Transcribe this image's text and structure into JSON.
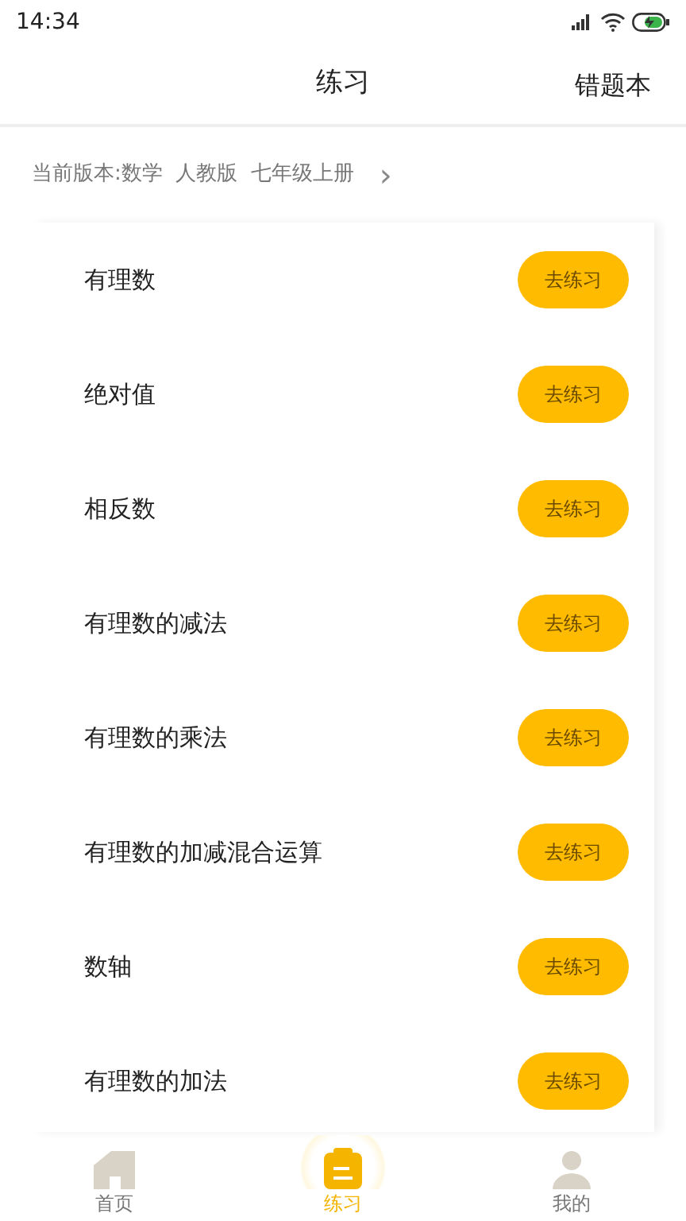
{
  "status_bar": {
    "time": "14:34"
  },
  "header": {
    "title": "练习",
    "action": "错题本"
  },
  "version": {
    "label": "当前版本:",
    "parts": [
      "数学",
      "人教版",
      "七年级上册"
    ],
    "chevron": "›"
  },
  "topics": [
    {
      "name": "有理数",
      "button": "去练习"
    },
    {
      "name": "绝对值",
      "button": "去练习"
    },
    {
      "name": "相反数",
      "button": "去练习"
    },
    {
      "name": "有理数的减法",
      "button": "去练习"
    },
    {
      "name": "有理数的乘法",
      "button": "去练习"
    },
    {
      "name": "有理数的加减混合运算",
      "button": "去练习"
    },
    {
      "name": "数轴",
      "button": "去练习"
    },
    {
      "name": "有理数的加法",
      "button": "去练习"
    }
  ],
  "tab_bar": [
    {
      "kind": "home",
      "label": "首页",
      "selected": false
    },
    {
      "kind": "practice",
      "label": "练习",
      "selected": true
    },
    {
      "kind": "me",
      "label": "我的",
      "selected": false
    }
  ]
}
